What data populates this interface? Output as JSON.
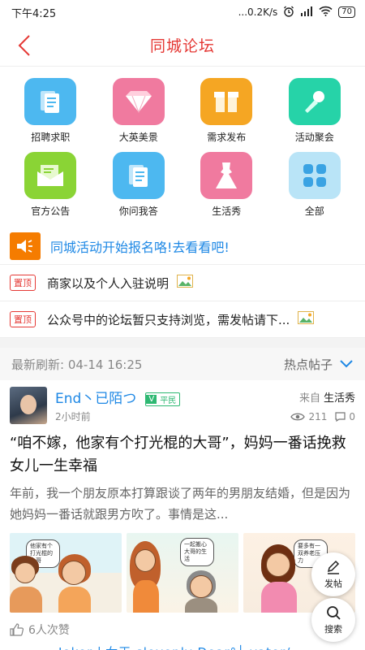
{
  "status_bar": {
    "time": "下午4:25",
    "speed": "...0.2K/s",
    "battery": "70"
  },
  "nav": {
    "title": "同城论坛"
  },
  "categories": [
    {
      "label": "招聘求职",
      "icon": "document-icon",
      "color": "#4db8f0"
    },
    {
      "label": "大英美景",
      "icon": "diamond-icon",
      "color": "#f07a9f"
    },
    {
      "label": "需求发布",
      "icon": "box-icon",
      "color": "#f5a623"
    },
    {
      "label": "活动聚会",
      "icon": "microphone-icon",
      "color": "#26d3a8"
    },
    {
      "label": "官方公告",
      "icon": "envelope-icon",
      "color": "#8ad435"
    },
    {
      "label": "你问我答",
      "icon": "document-icon",
      "color": "#4db8f0"
    },
    {
      "label": "生活秀",
      "icon": "dress-icon",
      "color": "#f07a9f"
    },
    {
      "label": "全部",
      "icon": "grid-icon",
      "color": "#b9e4f7"
    }
  ],
  "announcement": {
    "text": "同城活动开始报名咯!去看看吧!"
  },
  "pinned": [
    {
      "badge": "置顶",
      "text": "商家以及个人入驻说明"
    },
    {
      "badge": "置顶",
      "text": "公众号中的论坛暂只支持浏览，需发帖请下..."
    }
  ],
  "refresh": {
    "label": "最新刷新:",
    "time": "04-14 16:25",
    "sort": "热点帖子"
  },
  "post": {
    "username": "End丶已陌つ",
    "level_badge": "V",
    "level_name": "平民",
    "from_label": "来自",
    "from_category": "生活秀",
    "time": "2小时前",
    "views": "211",
    "comments": "0",
    "title": "“咱不嫁，他家有个打光棍的大哥”，妈妈一番话挽救女儿一生幸福",
    "excerpt": "年前，我一个朋友原本打算跟谈了两年的男朋友结婚，但是因为她妈妈一番话就跟男方吹了。事情是这...",
    "thumb_captions": [
      "他家有个打光棍的大哥",
      "一起搬心大哥的生活",
      "要多有一双养老压力"
    ],
    "likes": "6人次赞"
  },
  "next_post_preview": "Joker丿女王    slovenly  Dear°┘      yater/",
  "fabs": {
    "post_label": "发帖",
    "search_label": "搜索"
  }
}
